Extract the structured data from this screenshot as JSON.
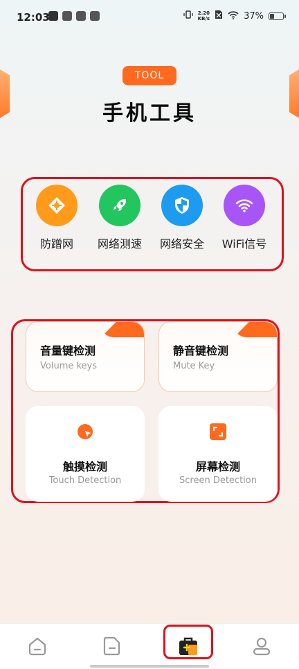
{
  "status_bar": {
    "time": "12:03",
    "net_speed_value": "2.20",
    "net_speed_unit": "KB/s",
    "battery_percent": "37%",
    "battery_level": 0.37
  },
  "header": {
    "badge": "TOOL",
    "title": "手机工具"
  },
  "tools": [
    {
      "label": "防蹭网",
      "icon": "shield-diamond-icon",
      "color": "#ff9a1a"
    },
    {
      "label": "网络测速",
      "icon": "rocket-icon",
      "color": "#22c55e"
    },
    {
      "label": "网络安全",
      "icon": "security-shield-icon",
      "color": "#1d9bf0"
    },
    {
      "label": "WiFi信号",
      "icon": "wifi-icon",
      "color": "#a855f7"
    }
  ],
  "cards": {
    "volume": {
      "title": "音量键检测",
      "subtitle": "Volume keys"
    },
    "mute": {
      "title": "静音键检测",
      "subtitle": "Mute Key"
    },
    "touch": {
      "title": "触摸检测",
      "subtitle": "Touch Detection",
      "icon": "touch-cursor-icon"
    },
    "screen": {
      "title": "屏幕检测",
      "subtitle": "Screen Detection",
      "icon": "screen-frame-icon"
    }
  },
  "accent_color": "#ff6a1e",
  "bottom_nav": [
    {
      "icon": "home-icon",
      "active": false
    },
    {
      "icon": "document-icon",
      "active": false
    },
    {
      "icon": "toolbox-icon",
      "active": true
    },
    {
      "icon": "profile-icon",
      "active": false
    }
  ]
}
